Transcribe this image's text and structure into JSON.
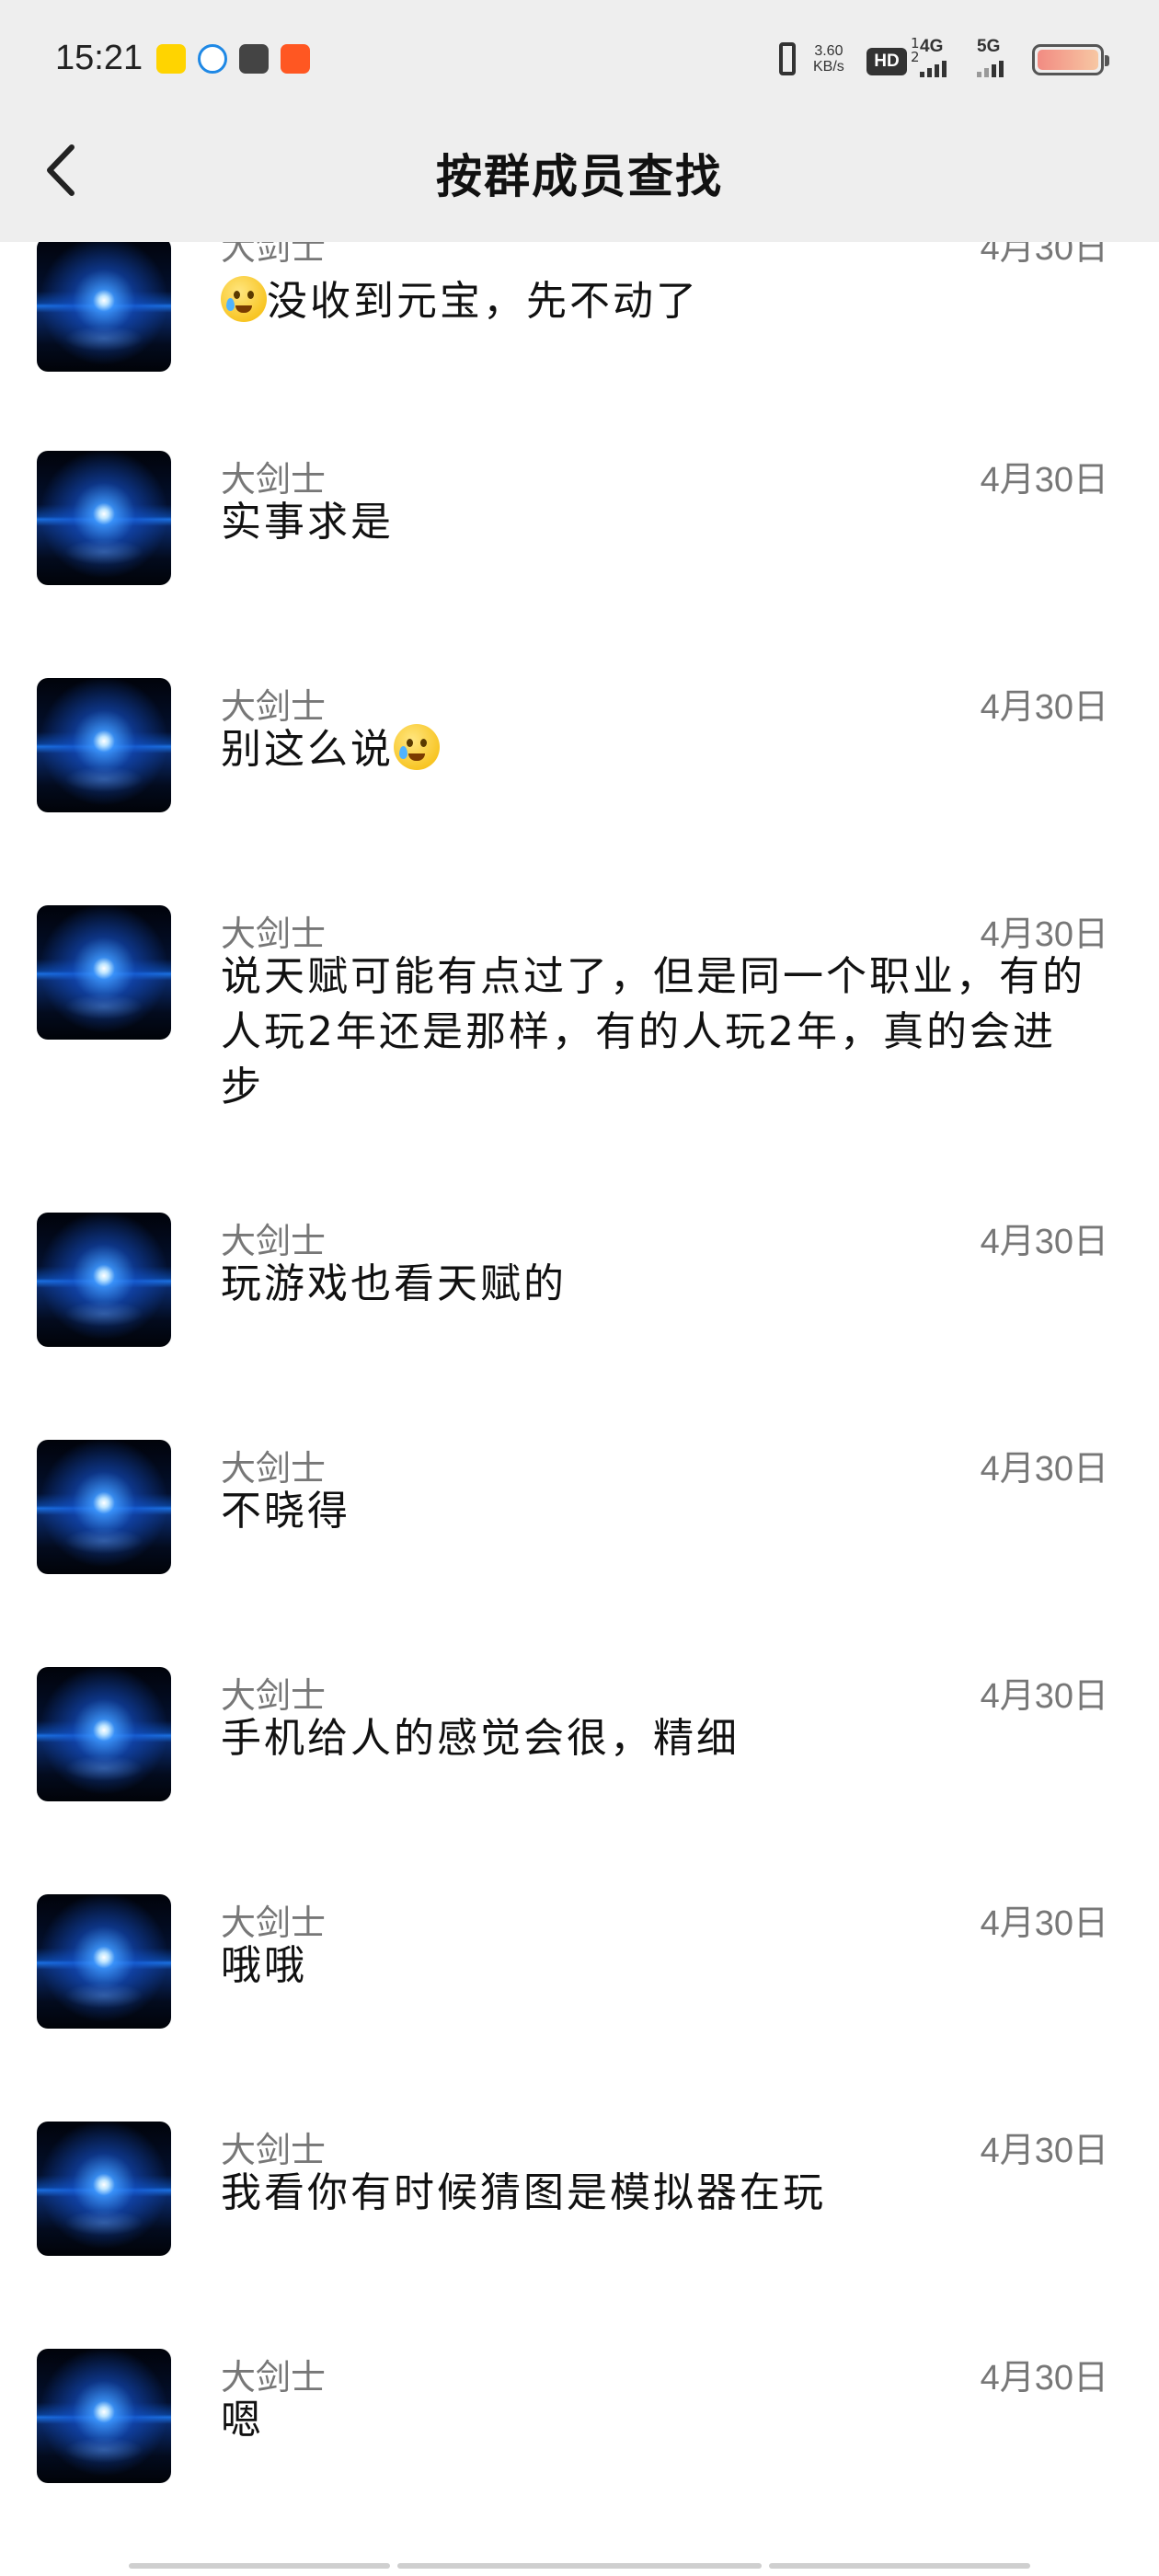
{
  "status_bar": {
    "time": "15:21",
    "net_speed_value": "3.60",
    "net_speed_unit": "KB/s",
    "hd_label": "HD",
    "hd_sub_top": "1",
    "hd_sub_bottom": "2",
    "network_1": "4G",
    "network_2": "5G",
    "battery_level": 0.2
  },
  "header": {
    "title": "按群成员查找"
  },
  "messages": [
    {
      "name": "大剑士",
      "date": "4月30日",
      "text": "没收到元宝，先不动了",
      "emoji": "teary-face-icon",
      "emoji_position": "before"
    },
    {
      "name": "大剑士",
      "date": "4月30日",
      "text": "实事求是"
    },
    {
      "name": "大剑士",
      "date": "4月30日",
      "text": "别这么说",
      "emoji": "rolling-laughing-icon",
      "emoji_position": "after"
    },
    {
      "name": "大剑士",
      "date": "4月30日",
      "text": "说天赋可能有点过了，但是同一个职业，有的人玩2年还是那样，有的人玩2年，真的会进步"
    },
    {
      "name": "大剑士",
      "date": "4月30日",
      "text": "玩游戏也看天赋的"
    },
    {
      "name": "大剑士",
      "date": "4月30日",
      "text": "不晓得"
    },
    {
      "name": "大剑士",
      "date": "4月30日",
      "text": "手机给人的感觉会很，精细"
    },
    {
      "name": "大剑士",
      "date": "4月30日",
      "text": "哦哦"
    },
    {
      "name": "大剑士",
      "date": "4月30日",
      "text": "我看你有时候猜图是模拟器在玩"
    },
    {
      "name": "大剑士",
      "date": "4月30日",
      "text": "嗯"
    }
  ]
}
